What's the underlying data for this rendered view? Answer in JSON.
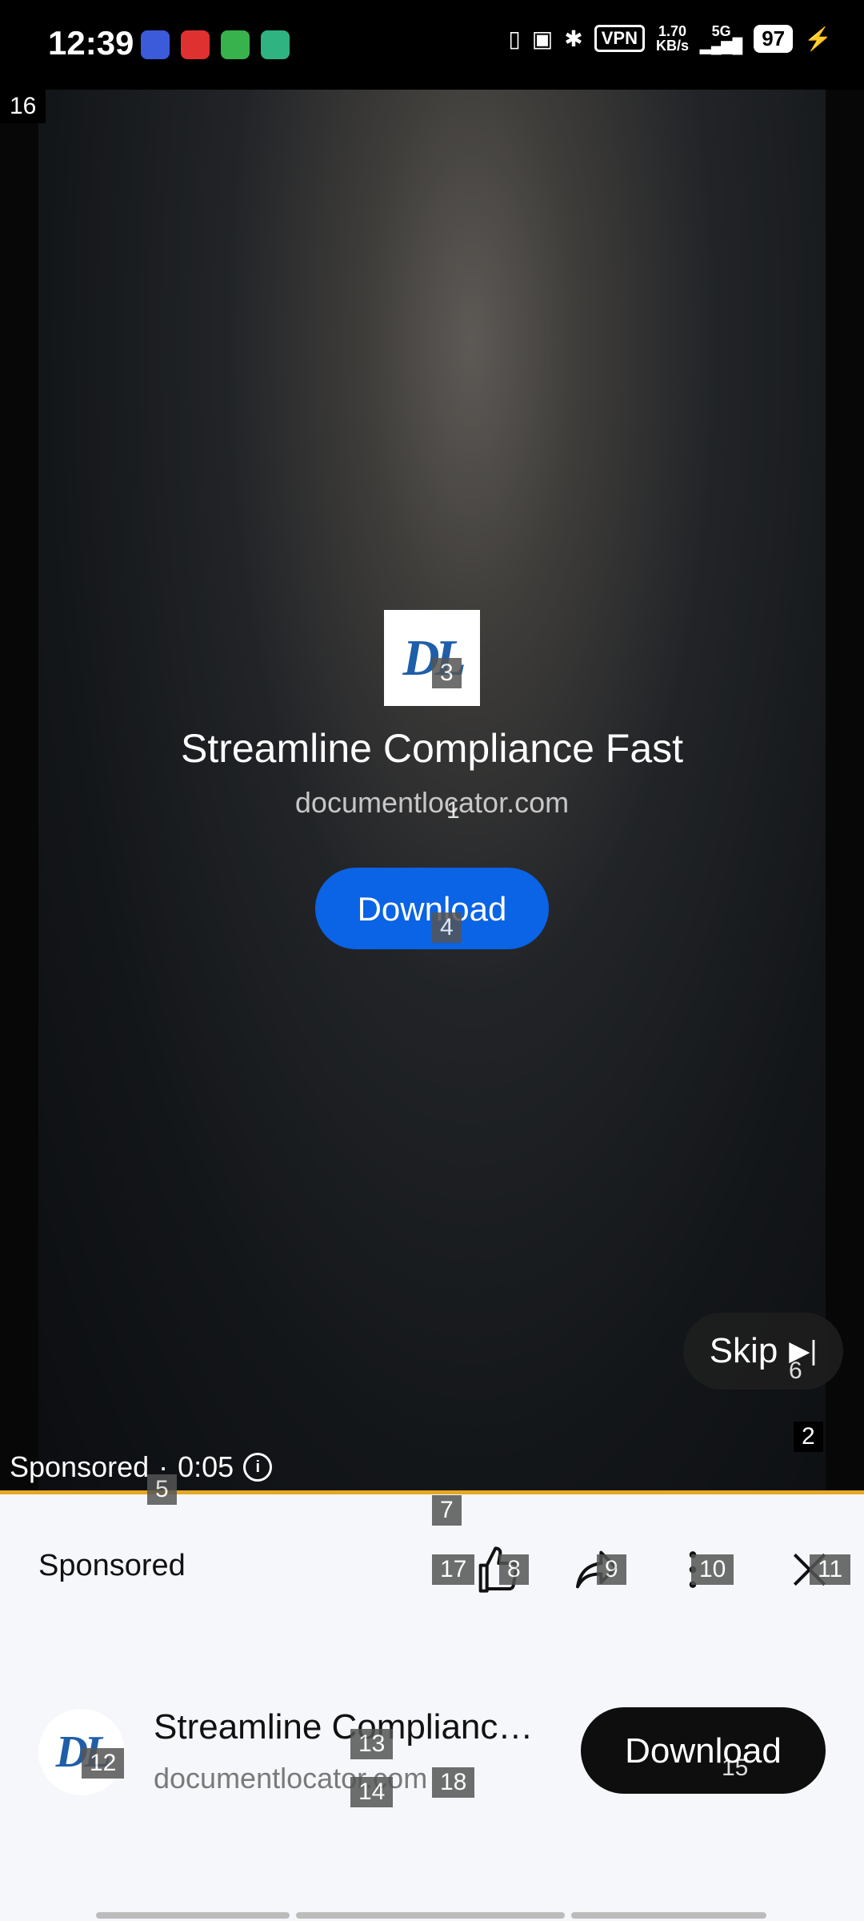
{
  "status_bar": {
    "time": "12:39",
    "vpn": "VPN",
    "speed_value": "1.70",
    "speed_unit": "KB/s",
    "network": "5G",
    "battery": "97"
  },
  "video": {
    "frame_marker": "16",
    "ad": {
      "logo_text": "DL",
      "title": "Streamline Compliance Fast",
      "domain": "documentlocator.com",
      "cta_label": "Download"
    },
    "skip_label": "Skip",
    "marker_2": "2",
    "sponsored_label": "Sponsored",
    "separator": "·",
    "time_left": "0:05"
  },
  "panel": {
    "sponsored_label": "Sponsored",
    "lower": {
      "logo_text": "DL",
      "title": "Streamline Compliance Fast",
      "domain": "documentlocator.com",
      "cta_label": "Download"
    }
  },
  "badges": [
    "3",
    "1",
    "4",
    "6",
    "5",
    "7",
    "17",
    "8",
    "9",
    "10",
    "11",
    "12",
    "13",
    "14",
    "18",
    "15"
  ],
  "colors": {
    "accent_blue": "#0b63e5",
    "progress": "#e5a823"
  }
}
